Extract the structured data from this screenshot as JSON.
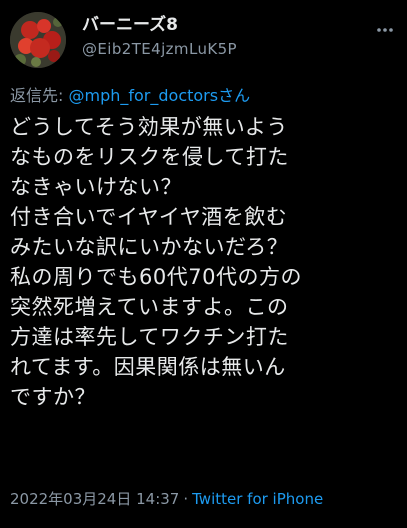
{
  "author": {
    "display_name": "バーニーズ8",
    "handle": "@Eib2TE4jzmLuK5P"
  },
  "reply": {
    "prefix": "返信先: ",
    "target": "@mph_for_doctorsさん"
  },
  "tweet": {
    "lines": [
      "どうしてそう効果が無いよう",
      "なものをリスクを侵して打た",
      "なきゃいけない？",
      "付き合いでイヤイヤ酒を飲む",
      "みたいな訳にいかないだろ？",
      "私の周りでも60代70代の方の",
      "突然死増えていますよ。この",
      "方達は率先してワクチン打た",
      "れてます。因果関係は無いん",
      "ですか？"
    ]
  },
  "meta": {
    "timestamp": "2022年03月24日 14:37",
    "separator": "·",
    "source": "Twitter for iPhone"
  },
  "icons": {
    "more": "more-options-icon",
    "avatar": "avatar"
  },
  "colors": {
    "background": "#000000",
    "text": "#e7e9ea",
    "muted": "#8b98a5",
    "accent": "#1d9bf0"
  }
}
